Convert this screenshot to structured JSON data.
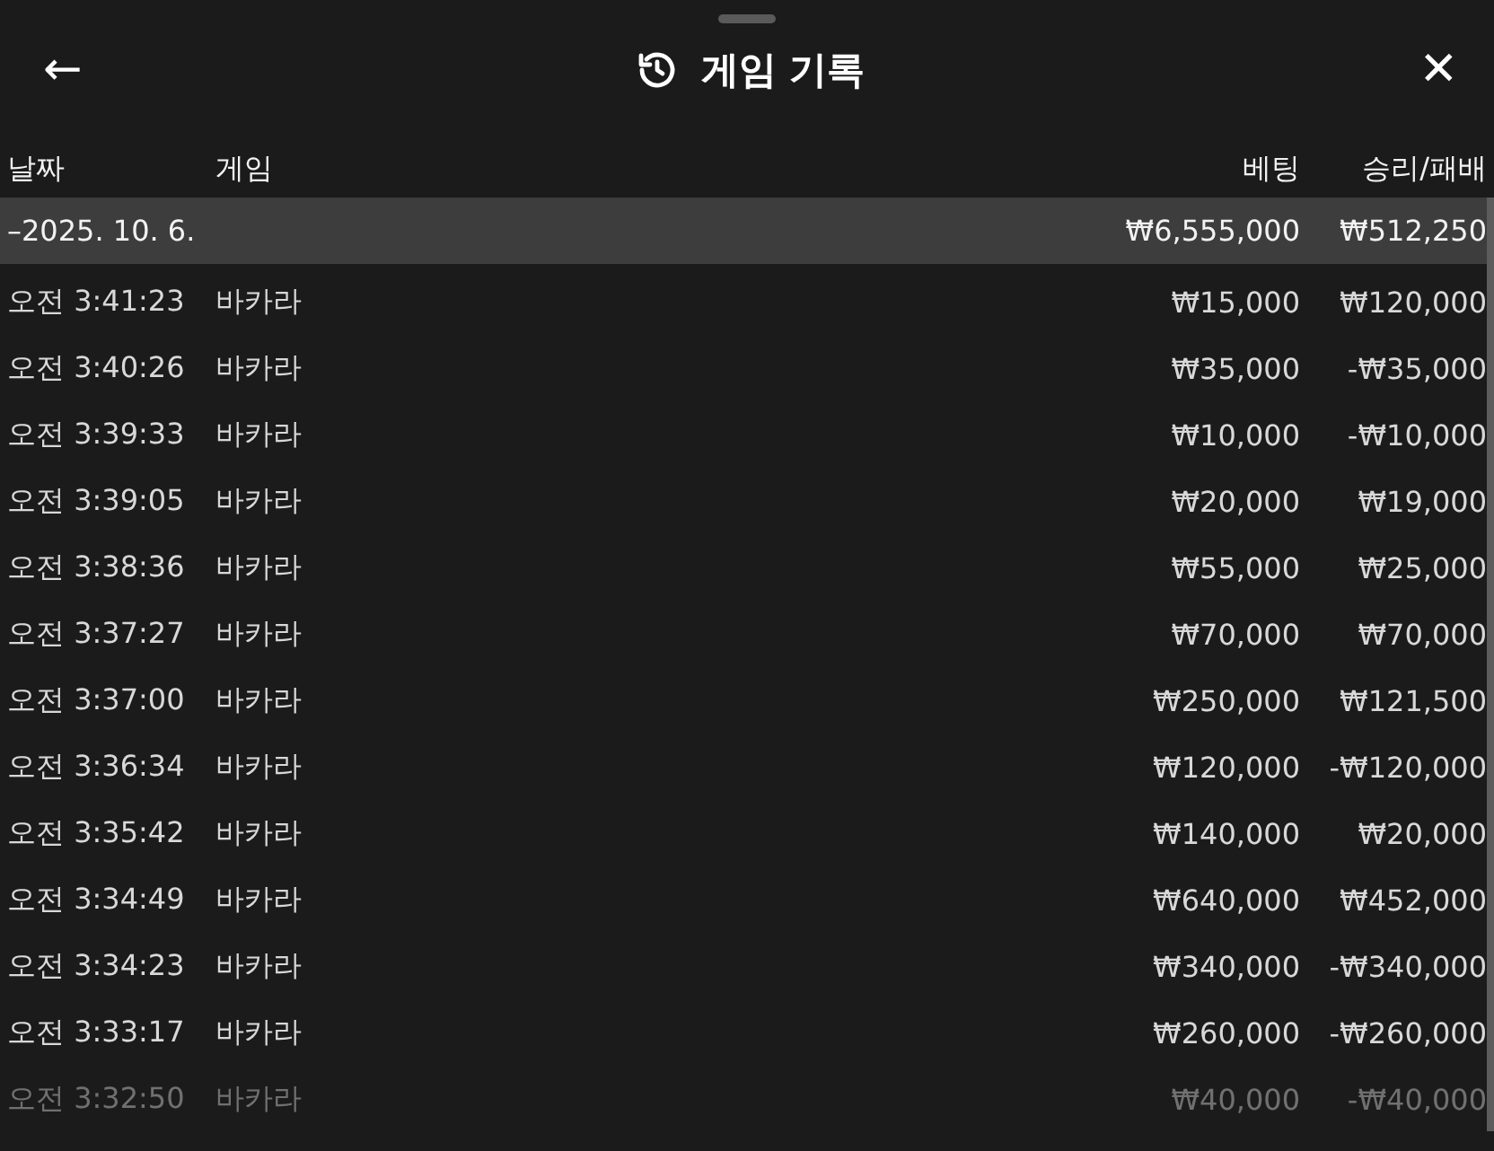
{
  "header": {
    "back": "←",
    "title": "게임 기록",
    "close": "✕"
  },
  "columns": [
    "날짜",
    "게임",
    "베팅",
    "승리/패배"
  ],
  "group": {
    "label": "–2025. 10. 6.",
    "bet": "₩6,555,000",
    "result": "₩512,250"
  },
  "rows": [
    {
      "time": "오전 3:41:23",
      "game": "바카라",
      "bet": "₩15,000",
      "result": "₩120,000",
      "faded": false
    },
    {
      "time": "오전 3:40:26",
      "game": "바카라",
      "bet": "₩35,000",
      "result": "-₩35,000",
      "faded": false
    },
    {
      "time": "오전 3:39:33",
      "game": "바카라",
      "bet": "₩10,000",
      "result": "-₩10,000",
      "faded": false
    },
    {
      "time": "오전 3:39:05",
      "game": "바카라",
      "bet": "₩20,000",
      "result": "₩19,000",
      "faded": false
    },
    {
      "time": "오전 3:38:36",
      "game": "바카라",
      "bet": "₩55,000",
      "result": "₩25,000",
      "faded": false
    },
    {
      "time": "오전 3:37:27",
      "game": "바카라",
      "bet": "₩70,000",
      "result": "₩70,000",
      "faded": false
    },
    {
      "time": "오전 3:37:00",
      "game": "바카라",
      "bet": "₩250,000",
      "result": "₩121,500",
      "faded": false
    },
    {
      "time": "오전 3:36:34",
      "game": "바카라",
      "bet": "₩120,000",
      "result": "-₩120,000",
      "faded": false
    },
    {
      "time": "오전 3:35:42",
      "game": "바카라",
      "bet": "₩140,000",
      "result": "₩20,000",
      "faded": false
    },
    {
      "time": "오전 3:34:49",
      "game": "바카라",
      "bet": "₩640,000",
      "result": "₩452,000",
      "faded": false
    },
    {
      "time": "오전 3:34:23",
      "game": "바카라",
      "bet": "₩340,000",
      "result": "-₩340,000",
      "faded": false
    },
    {
      "time": "오전 3:33:17",
      "game": "바카라",
      "bet": "₩260,000",
      "result": "-₩260,000",
      "faded": false
    },
    {
      "time": "오전 3:32:50",
      "game": "바카라",
      "bet": "₩40,000",
      "result": "-₩40,000",
      "faded": true
    }
  ]
}
